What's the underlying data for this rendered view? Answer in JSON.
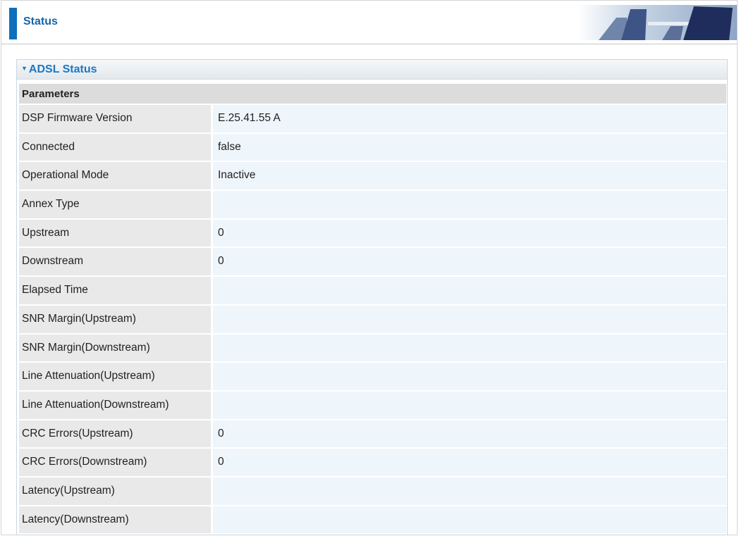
{
  "header": {
    "title": "Status",
    "graphic_icon": "office-chairs-banner"
  },
  "panel": {
    "title": "ADSL Status",
    "caret_icon": "triangle-down-icon",
    "params_header": "Parameters",
    "rows": [
      {
        "label": "DSP Firmware Version",
        "value": "E.25.41.55 A"
      },
      {
        "label": "Connected",
        "value": "false"
      },
      {
        "label": "Operational Mode",
        "value": "Inactive"
      },
      {
        "label": "Annex Type",
        "value": ""
      },
      {
        "label": "Upstream",
        "value": "0"
      },
      {
        "label": "Downstream",
        "value": "0"
      },
      {
        "label": "Elapsed Time",
        "value": ""
      },
      {
        "label": "SNR Margin(Upstream)",
        "value": ""
      },
      {
        "label": "SNR Margin(Downstream)",
        "value": ""
      },
      {
        "label": "Line Attenuation(Upstream)",
        "value": ""
      },
      {
        "label": "Line Attenuation(Downstream)",
        "value": ""
      },
      {
        "label": "CRC Errors(Upstream)",
        "value": "0"
      },
      {
        "label": "CRC Errors(Downstream)",
        "value": "0"
      },
      {
        "label": "Latency(Upstream)",
        "value": ""
      },
      {
        "label": "Latency(Downstream)",
        "value": ""
      }
    ]
  },
  "colors": {
    "accent": "#0f6fbd",
    "title_text": "#1465a8",
    "panel_title": "#1a78c2",
    "label_bg": "#e9e9e9",
    "value_bg": "#eef5fb",
    "params_bg": "#dcdcdc"
  }
}
